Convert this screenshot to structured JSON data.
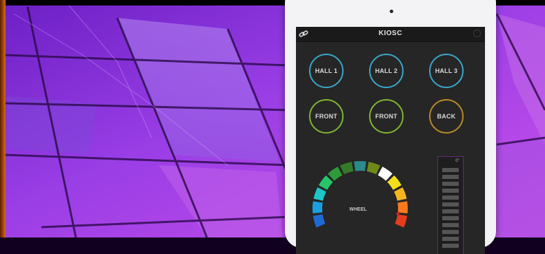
{
  "app": {
    "title": "KIOSC"
  },
  "buttons": [
    {
      "label": "HALL 1",
      "color": "#3aa7c9"
    },
    {
      "label": "HALL 2",
      "color": "#3aa7c9"
    },
    {
      "label": "HALL 3",
      "color": "#3aa7c9"
    },
    {
      "label": "FRONT",
      "color": "#7fb72f"
    },
    {
      "label": "FRONT",
      "color": "#7fb72f"
    },
    {
      "label": "BACK",
      "color": "#b98a2a"
    }
  ],
  "wheel": {
    "label": "WHEEL",
    "segment_colors": [
      "#1f6bd6",
      "#1aa0e0",
      "#1ec6c8",
      "#28c46a",
      "#2e9a38",
      "#357a2a",
      "#2b8a8a",
      "#6e8a18",
      "#ffffff",
      "#f2df1a",
      "#f5b41e",
      "#f57a1e",
      "#e33d1e"
    ]
  },
  "fader": {
    "value": "0°"
  },
  "colors": {
    "accent_blue": "#3aa7c9",
    "accent_green": "#7fb72f",
    "accent_orange": "#b98a2a",
    "fader_border": "#6a2a7a"
  },
  "icons": {
    "link": "link-icon",
    "menu": "menu-dot-icon"
  }
}
